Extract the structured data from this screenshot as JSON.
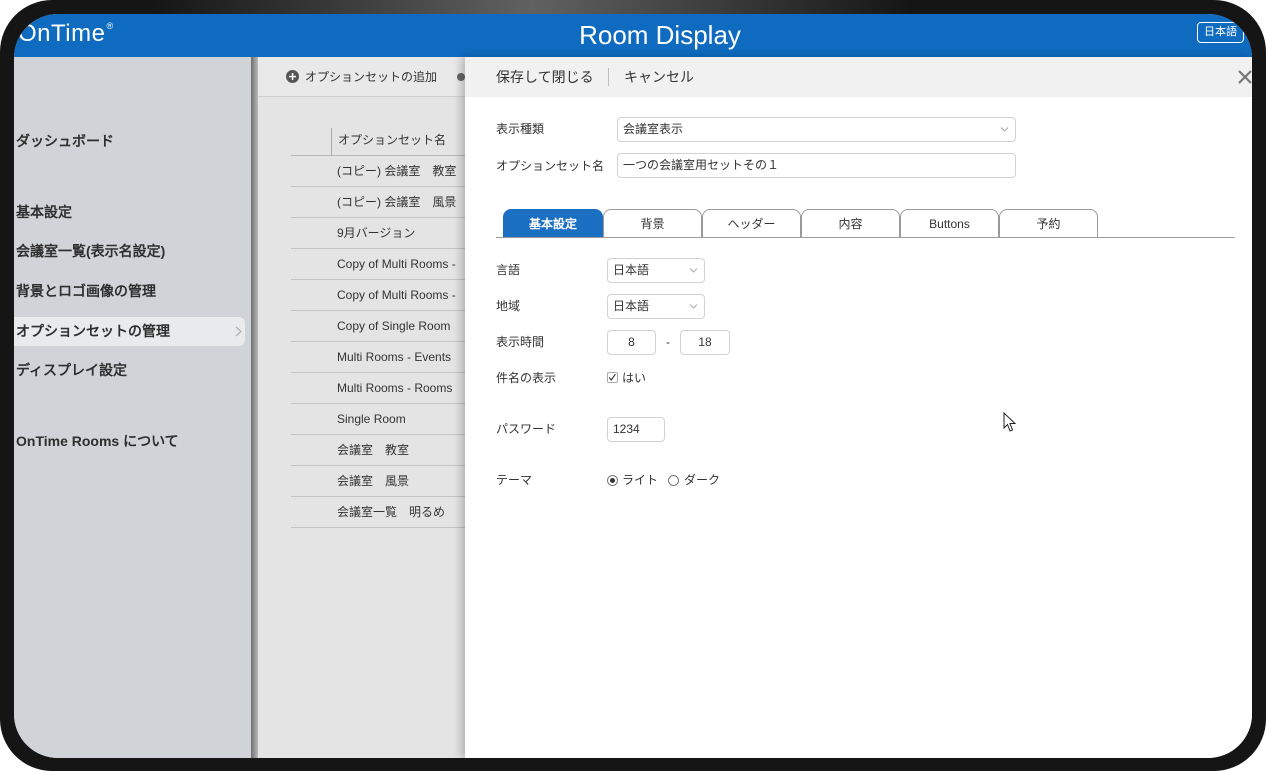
{
  "app": {
    "logo": "OnTime",
    "logo_mark": "®",
    "title": "Room Display",
    "language_button": "日本語"
  },
  "sidebar": {
    "items": [
      {
        "label": "ダッシュボード"
      },
      {
        "label": "基本設定"
      },
      {
        "label": "会議室一覧(表示名設定)"
      },
      {
        "label": "背景とロゴ画像の管理"
      },
      {
        "label": "オプションセットの管理",
        "selected": true
      },
      {
        "label": "ディスプレイ設定"
      },
      {
        "label": "OnTime Rooms について"
      }
    ]
  },
  "option_sets": {
    "add_label": "オプションセットの追加",
    "column_header": "オプションセット名",
    "rows": [
      "(コピー) 会議室　教室",
      "(コピー) 会議室　風景",
      "9月バージョン",
      "Copy of Multi Rooms -",
      "Copy of Multi Rooms -",
      "Copy of Single Room",
      "Multi Rooms - Events",
      "Multi Rooms - Rooms",
      "Single Room",
      "会議室　教室",
      "会議室　風景",
      "会議室一覧　明るめ"
    ]
  },
  "editor": {
    "save_label": "保存して閉じる",
    "cancel_label": "キャンセル",
    "display_type": {
      "label": "表示種類",
      "value": "会議室表示"
    },
    "set_name": {
      "label": "オプションセット名",
      "value": "一つの会議室用セットその１"
    },
    "tabs": [
      {
        "label": "基本設定",
        "active": true
      },
      {
        "label": "背景"
      },
      {
        "label": "ヘッダー"
      },
      {
        "label": "内容"
      },
      {
        "label": "Buttons"
      },
      {
        "label": "予約"
      }
    ],
    "language": {
      "label": "言語",
      "value": "日本語"
    },
    "region": {
      "label": "地域",
      "value": "日本語"
    },
    "display_time": {
      "label": "表示時間",
      "start": "8",
      "separator": "-",
      "end": "18"
    },
    "subject_display": {
      "label": "件名の表示",
      "checked": true,
      "option": "はい"
    },
    "password": {
      "label": "パスワード",
      "value": "1234"
    },
    "theme": {
      "label": "テーマ",
      "options": [
        "ライト",
        "ダーク"
      ],
      "selected": "ライト"
    }
  },
  "icons": {
    "add": "plus-circle-icon",
    "close": "close-icon",
    "select": "chevron-down-icon",
    "selected_nav": "chevron-right-icon",
    "checkbox": "check-icon",
    "cursor": "mouse-pointer-icon"
  },
  "colors": {
    "header": "#0e6bbf",
    "active_tab": "#1b6fc2",
    "sidebar": "#d0d4d8",
    "panel": "#e4e4e4",
    "editor": "#ffffff"
  }
}
